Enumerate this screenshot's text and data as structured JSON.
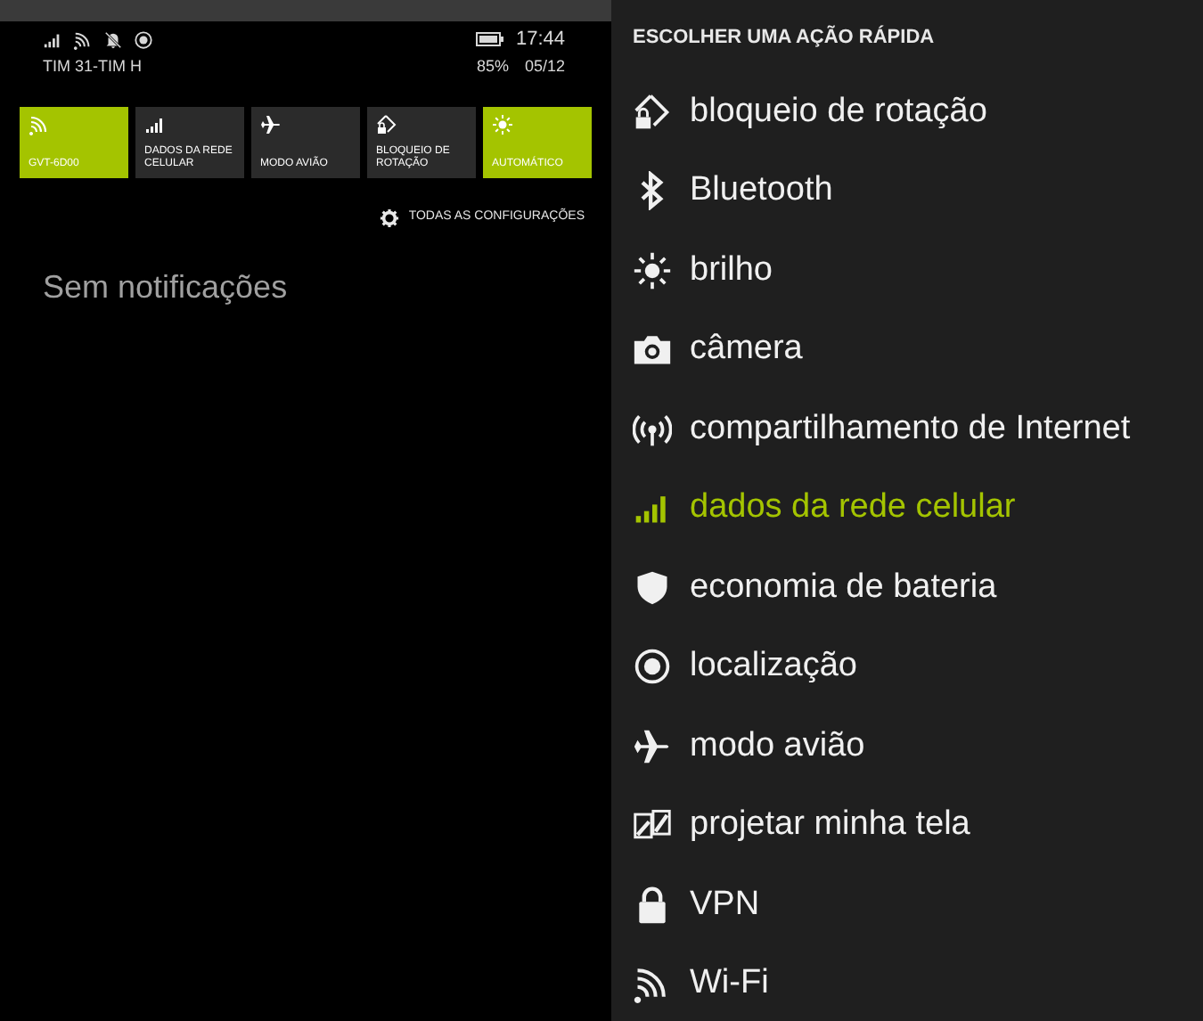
{
  "status_bar": {
    "carrier": "TIM 31-TIM H",
    "time": "17:44",
    "battery": "85%",
    "date": "05/12"
  },
  "quick_actions": [
    {
      "kind": "wifi",
      "label": "GVT-6D00",
      "on": true
    },
    {
      "kind": "cellular",
      "label": "DADOS DA REDE CELULAR",
      "on": false
    },
    {
      "kind": "airplane",
      "label": "MODO AVIÃO",
      "on": false
    },
    {
      "kind": "rotation",
      "label": "BLOQUEIO DE ROTAÇÃO",
      "on": false
    },
    {
      "kind": "brightness",
      "label": "AUTOMÁTICO",
      "on": true
    }
  ],
  "settings_link": "TODAS AS CONFIGURAÇÕES",
  "notifications_empty": "Sem notificações",
  "picker": {
    "title": "ESCOLHER UMA AÇÃO RÁPIDA",
    "items": [
      {
        "kind": "rotation",
        "label": "bloqueio de rotação",
        "selected": false
      },
      {
        "kind": "bluetooth",
        "label": "Bluetooth",
        "selected": false
      },
      {
        "kind": "brightness",
        "label": "brilho",
        "selected": false
      },
      {
        "kind": "camera",
        "label": "câmera",
        "selected": false
      },
      {
        "kind": "hotspot",
        "label": "compartilhamento de Internet",
        "selected": false
      },
      {
        "kind": "cellular",
        "label": "dados da rede celular",
        "selected": true
      },
      {
        "kind": "shield",
        "label": "economia de bateria",
        "selected": false
      },
      {
        "kind": "location",
        "label": "localização",
        "selected": false
      },
      {
        "kind": "airplane",
        "label": "modo avião",
        "selected": false
      },
      {
        "kind": "project",
        "label": "projetar minha tela",
        "selected": false
      },
      {
        "kind": "lock",
        "label": "VPN",
        "selected": false
      },
      {
        "kind": "wifi",
        "label": "Wi-Fi",
        "selected": false
      }
    ]
  }
}
